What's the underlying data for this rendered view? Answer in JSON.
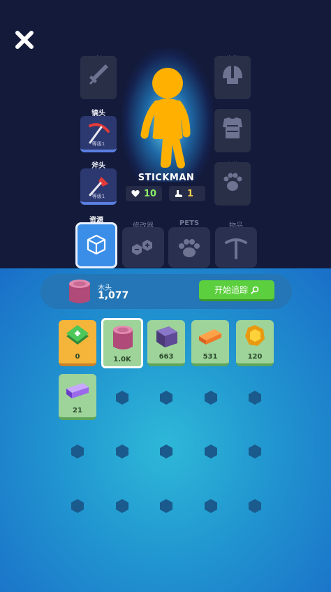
{
  "equipment": {
    "sword_label": "剑",
    "pickaxe_label": "镐头",
    "pickaxe_level": "等级1",
    "axe_label": "斧头",
    "axe_level": "等级1",
    "helmet_label": "头盔",
    "armor_label": "胸甲",
    "pet_label": "宠物"
  },
  "hero": {
    "name": "STICKMAN",
    "health": "10",
    "power": "1"
  },
  "tabs": [
    {
      "label": "资源"
    },
    {
      "label": "修改器"
    },
    {
      "label": "PETS"
    },
    {
      "label": "物品"
    }
  ],
  "resource": {
    "name": "木头",
    "count": "1,077",
    "track_label": "开始追踪"
  },
  "inventory": [
    {
      "item": "cash-bundle",
      "count": "0"
    },
    {
      "item": "wood-log",
      "count": "1.0K"
    },
    {
      "item": "stone-cube",
      "count": "663"
    },
    {
      "item": "copper-bar",
      "count": "531"
    },
    {
      "item": "gold-ore",
      "count": "120"
    },
    {
      "item": "crystal-bar",
      "count": "21"
    }
  ],
  "colors": {
    "accent_blue": "#3a8ee8",
    "track_green": "#5ccf3e",
    "hero_orange": "#ffb000"
  }
}
